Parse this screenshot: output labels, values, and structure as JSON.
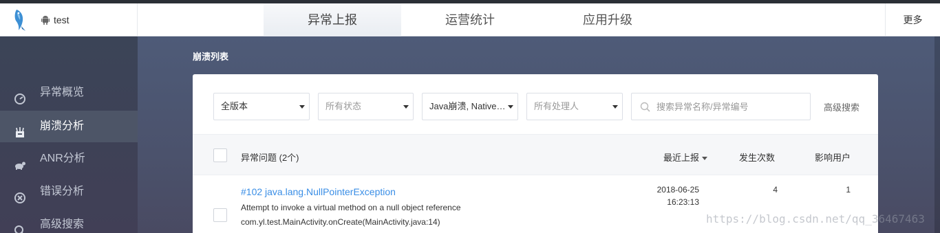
{
  "header": {
    "app_name": "test",
    "tabs": [
      {
        "label": "异常上报"
      },
      {
        "label": "运营统计"
      },
      {
        "label": "应用升级"
      }
    ],
    "more_label": "更多"
  },
  "sidebar": {
    "items": [
      {
        "label": "异常概览",
        "icon": "dashboard-icon"
      },
      {
        "label": "崩溃分析",
        "icon": "crash-icon"
      },
      {
        "label": "ANR分析",
        "icon": "anr-icon"
      },
      {
        "label": "错误分析",
        "icon": "error-icon"
      },
      {
        "label": "高级搜索",
        "icon": "search-icon"
      }
    ],
    "active_index": 1
  },
  "main": {
    "section_title": "崩溃列表",
    "filters": {
      "version": "全版本",
      "status_placeholder": "所有状态",
      "type": "Java崩溃, Native…",
      "handler_placeholder": "所有处理人",
      "search_placeholder": "搜索异常名称/异常编号",
      "advanced_search": "高级搜索"
    },
    "table": {
      "columns": {
        "issue": "异常问题 (2个)",
        "last_report": "最近上报",
        "count": "发生次数",
        "users": "影响用户"
      },
      "rows": [
        {
          "title": "#102 java.lang.NullPointerException",
          "description": "Attempt to invoke a virtual method on a null object reference",
          "location": "com.yl.test.MainActivity.onCreate(MainActivity.java:14)",
          "date": "2018-06-25",
          "time": "16:23:13",
          "count": "4",
          "users": "1"
        }
      ]
    }
  },
  "watermark": "https://blog.csdn.net/qq_36467463",
  "colors": {
    "link": "#3a8ee6",
    "sidebar_bg": "#3b4457",
    "main_bg": "#4e5b78"
  }
}
